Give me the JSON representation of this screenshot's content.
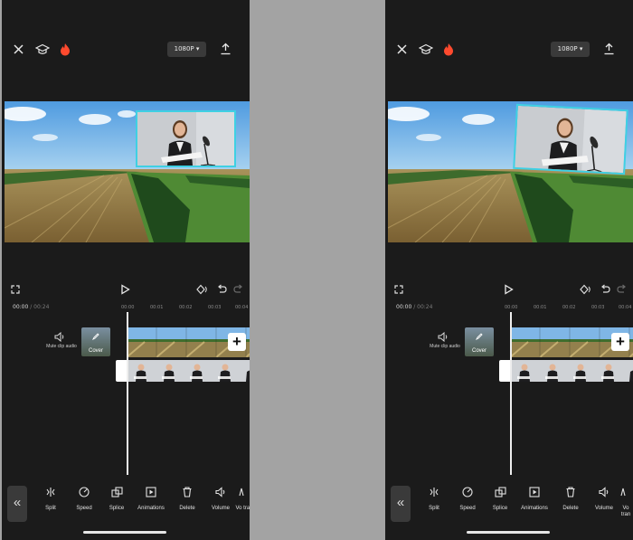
{
  "topbar": {
    "close_icon": "close-icon",
    "tutorial_icon": "graduation-cap-icon",
    "hot_icon": "flame-icon",
    "resolution_label": "1080P ▾",
    "export_icon": "export-icon"
  },
  "controls": {
    "fullscreen_icon": "fullscreen-icon",
    "play_icon": "play-icon",
    "keyframe_icon": "keyframe-icon",
    "undo_icon": "undo-icon",
    "redo_icon": "redo-icon"
  },
  "timeline": {
    "current_time": "00:00",
    "total_time": "/ 00:24",
    "ruler_marks": [
      "00:00",
      "00:01",
      "00:02",
      "00:03",
      "00:04"
    ],
    "mute_label": "Mute clip audio",
    "cover_label": "Cover"
  },
  "toolbar": {
    "items": [
      {
        "label": "Split",
        "icon": "split-icon"
      },
      {
        "label": "Speed",
        "icon": "speed-icon"
      },
      {
        "label": "Splice",
        "icon": "splice-icon"
      },
      {
        "label": "Animations",
        "icon": "animations-icon"
      },
      {
        "label": "Delete",
        "icon": "delete-icon"
      },
      {
        "label": "Volume",
        "icon": "volume-icon"
      },
      {
        "label": "Vo tran",
        "icon": "voice-icon"
      }
    ]
  },
  "colors": {
    "app_background": "#1b1b1b",
    "side_gutter": "#a3a3a3",
    "overlay_border": "#3fd0e3",
    "flame": "#ff4a2e"
  }
}
